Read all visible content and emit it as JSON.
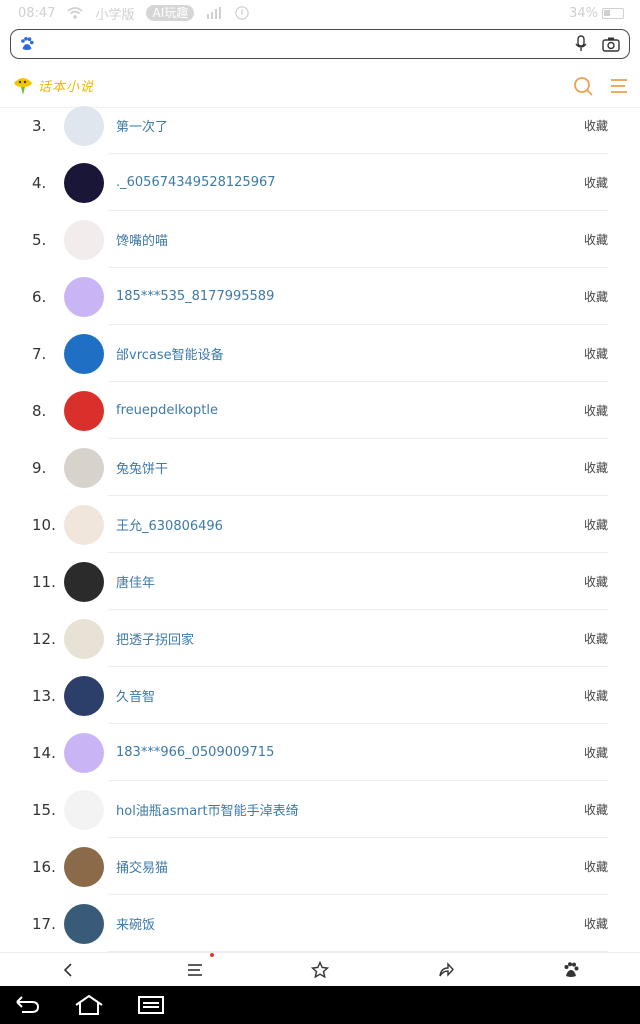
{
  "status_bar": {
    "time": "08:47",
    "app_label": "小学版",
    "chip_label": "AI玩趣",
    "battery": "34%"
  },
  "search": {
    "value": "",
    "placeholder": ""
  },
  "site": {
    "logo_text": "话本小说"
  },
  "icons": {
    "search": "search-icon",
    "menu": "menu-icon",
    "mic": "microphone-icon",
    "camera": "camera-icon"
  },
  "accent_color": "#f0a050",
  "link_color": "#3e7aa8",
  "list": {
    "action_label": "收藏",
    "items": [
      {
        "rank": "3.",
        "name": "第一次了"
      },
      {
        "rank": "4.",
        "name": "._605674349528125967"
      },
      {
        "rank": "5.",
        "name": "馋嘴的喵"
      },
      {
        "rank": "6.",
        "name": "185***535_8177995589"
      },
      {
        "rank": "7.",
        "name": "邰vrcase智能设备"
      },
      {
        "rank": "8.",
        "name": "freuepdelkoptle"
      },
      {
        "rank": "9.",
        "name": "兔兔饼干"
      },
      {
        "rank": "10.",
        "name": "王允_630806496"
      },
      {
        "rank": "11.",
        "name": "唐佳年"
      },
      {
        "rank": "12.",
        "name": "把透子拐回家"
      },
      {
        "rank": "13.",
        "name": "久音智"
      },
      {
        "rank": "14.",
        "name": "183***966_0509009715"
      },
      {
        "rank": "15.",
        "name": "hol油瓶asmart帀智能手淖表绮"
      },
      {
        "rank": "16.",
        "name": "捅交易猫"
      },
      {
        "rank": "17.",
        "name": "来碗饭"
      }
    ]
  },
  "toolbar": {
    "back": "back-icon",
    "menu": "menu-icon",
    "favorite": "star-icon",
    "share": "share-icon",
    "home": "baidu-paw-icon"
  }
}
